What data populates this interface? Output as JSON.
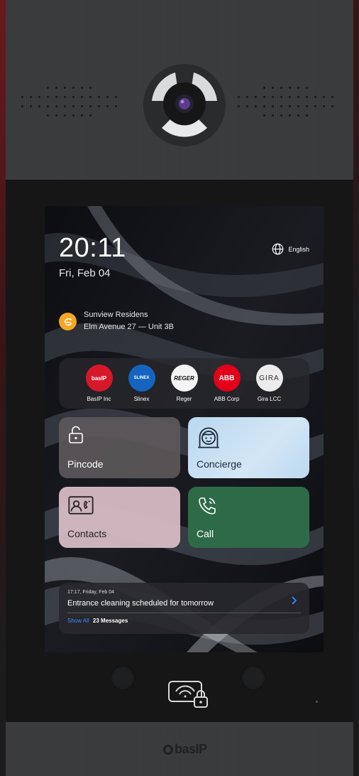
{
  "screen": {
    "time": "20:11",
    "date": "Fri, Feb 04",
    "language": "English",
    "residence": {
      "name": "Sunview Residens",
      "address": "Elm Avenue 27 — Unit 3B"
    },
    "brands": [
      {
        "name": "BasIP Inc",
        "logo_text": "basIP",
        "color": "#d7182a",
        "text_color": "#ffffff"
      },
      {
        "name": "Slinex",
        "logo_text": "SLINEX",
        "color": "#1565c0",
        "text_color": "#ffffff"
      },
      {
        "name": "Reger",
        "logo_text": "REGER",
        "color": "#f4f4f4",
        "text_color": "#111111"
      },
      {
        "name": "ABB Corp",
        "logo_text": "ABB",
        "color": "#e3001b",
        "text_color": "#ffffff"
      },
      {
        "name": "Gira LCC",
        "logo_text": "GIRA",
        "color": "#ececec",
        "text_color": "#333333"
      }
    ],
    "tiles": {
      "pincode": "Pincode",
      "concierge": "Concierge",
      "contacts": "Contacts",
      "call": "Call"
    },
    "notification": {
      "timestamp": "17:17, Friday, Feb 04",
      "message": "Entrance cleaning scheduled for tomorrow",
      "show_all": "Show All",
      "count": "23 Messages"
    }
  },
  "device": {
    "brand": "basIP"
  },
  "colors": {
    "accent_blue": "#3b8cff",
    "call_green": "#2f6a48",
    "residence_orange": "#f5a623"
  }
}
